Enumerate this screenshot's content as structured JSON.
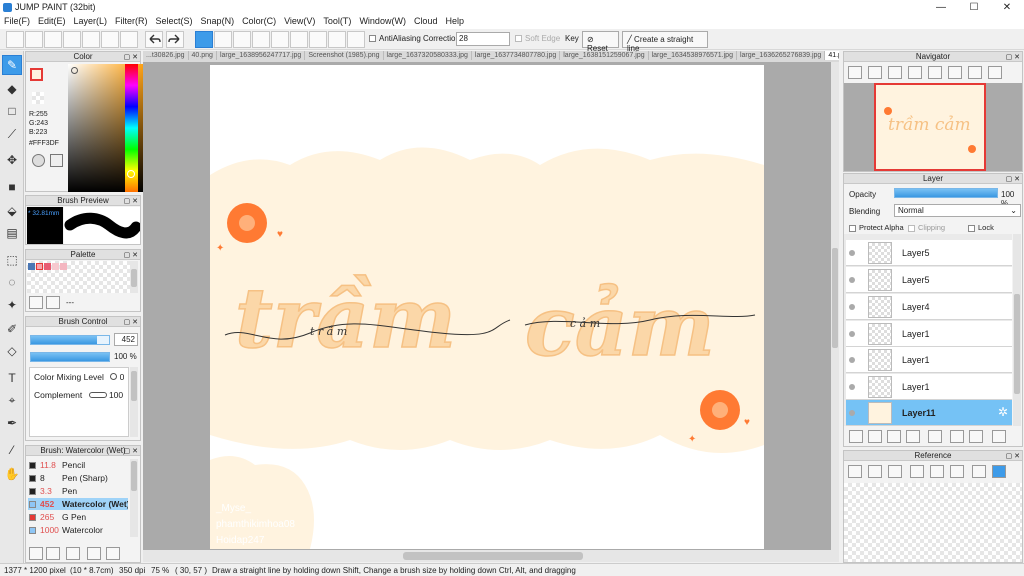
{
  "window": {
    "title": "JUMP PAINT (32bit)",
    "min_glyph": "—",
    "max_glyph": "☐",
    "close_glyph": "✕"
  },
  "menu": [
    "File(F)",
    "Edit(E)",
    "Layer(L)",
    "Filter(R)",
    "Select(S)",
    "Snap(N)",
    "Color(C)",
    "View(V)",
    "Tool(T)",
    "Window(W)",
    "Cloud",
    "Help"
  ],
  "toolbar": {
    "antialiasing_label": "AntiAliasing",
    "correction_label": "Correction",
    "correction_value": "28",
    "soft_edge_label": "Soft Edge",
    "key_label": "Key",
    "reset_label": "Reset",
    "straight_line_label": "Create a straight line"
  },
  "color_panel": {
    "title": "Color",
    "r": "R:255",
    "g": "G:243",
    "b": "B:223",
    "hex": "#FFF3DF",
    "primary_color": "#FFF3DF",
    "accent_red": "#e53935"
  },
  "brush_preview": {
    "title": "Brush Preview",
    "size": "32.81mm"
  },
  "palette": {
    "title": "Palette",
    "swatches": [
      "#4a77b4",
      "#f6a2ad",
      "#e85c73",
      "#f7c9cf",
      "#f4b6c0"
    ]
  },
  "brush_control": {
    "title": "Brush Control",
    "size_value": "452",
    "opacity_value": "100 %",
    "size_fill": 0.85,
    "opacity_fill": 1.0,
    "color_mixing_label": "Color Mixing Level",
    "color_mixing_value": "0",
    "complement_label": "Complement",
    "complement_value": "100"
  },
  "brush_list": {
    "title": "Brush: Watercolor (Wet)",
    "items": [
      {
        "size": "11.8",
        "name": "Pencil",
        "color": "#222222"
      },
      {
        "size": "8",
        "name": "Pen (Sharp)",
        "color": "#222222"
      },
      {
        "size": "3.3",
        "name": "Pen",
        "color": "#222222"
      },
      {
        "size": "452",
        "name": "Watercolor (Wet)",
        "color": "#8ec6f5"
      },
      {
        "size": "265",
        "name": "G Pen",
        "color": "#e53935"
      },
      {
        "size": "1000",
        "name": "Watercolor",
        "color": "#8ec6f5"
      }
    ]
  },
  "tabs": [
    "...t30826.jpg",
    "40.png",
    "large_1638956247717.jpg",
    "Screenshot (1985).png",
    "large_1637320580333.jpg",
    "large_1637734807780.jpg",
    "large_1638151259067.jpg",
    "large_1634538976571.jpg",
    "large_1636265276839.jpg",
    "41.png"
  ],
  "active_tab": "41.png",
  "artwork": {
    "word1": "trầm",
    "word2": "cảm",
    "script1": "t r ầ m",
    "script2": "c ả m",
    "watermark": [
      "_Myse_",
      "phamthikimhoa08",
      "Hoidap247"
    ],
    "bg_color": "#FFF3DF",
    "text_color": "#FBD7A8",
    "accent_color": "#FF7A33"
  },
  "navigator": {
    "title": "Navigator",
    "preview_text": "trầm cảm"
  },
  "layer_panel": {
    "title": "Layer",
    "opacity_label": "Opacity",
    "opacity_value": "100 %",
    "blending_label": "Blending",
    "blending_value": "Normal",
    "protect_alpha_label": "Protect Alpha",
    "clipping_label": "Clipping",
    "lock_label": "Lock",
    "layers": [
      {
        "name": "Layer5",
        "selected": false
      },
      {
        "name": "Layer5",
        "selected": false
      },
      {
        "name": "Layer4",
        "selected": false
      },
      {
        "name": "Layer1",
        "selected": false
      },
      {
        "name": "Layer1",
        "selected": false
      },
      {
        "name": "Layer1",
        "selected": false
      },
      {
        "name": "Layer11",
        "selected": true
      }
    ]
  },
  "reference": {
    "title": "Reference"
  },
  "status": {
    "dimensions": "1377 * 1200 pixel",
    "physical": "(10 * 8.7cm)",
    "dpi": "350 dpi",
    "zoom": "75 %",
    "coords": "( 30, 57 )",
    "hint": "Draw a straight line by holding down Shift, Change a brush size by holding down Ctrl, Alt, and dragging"
  }
}
